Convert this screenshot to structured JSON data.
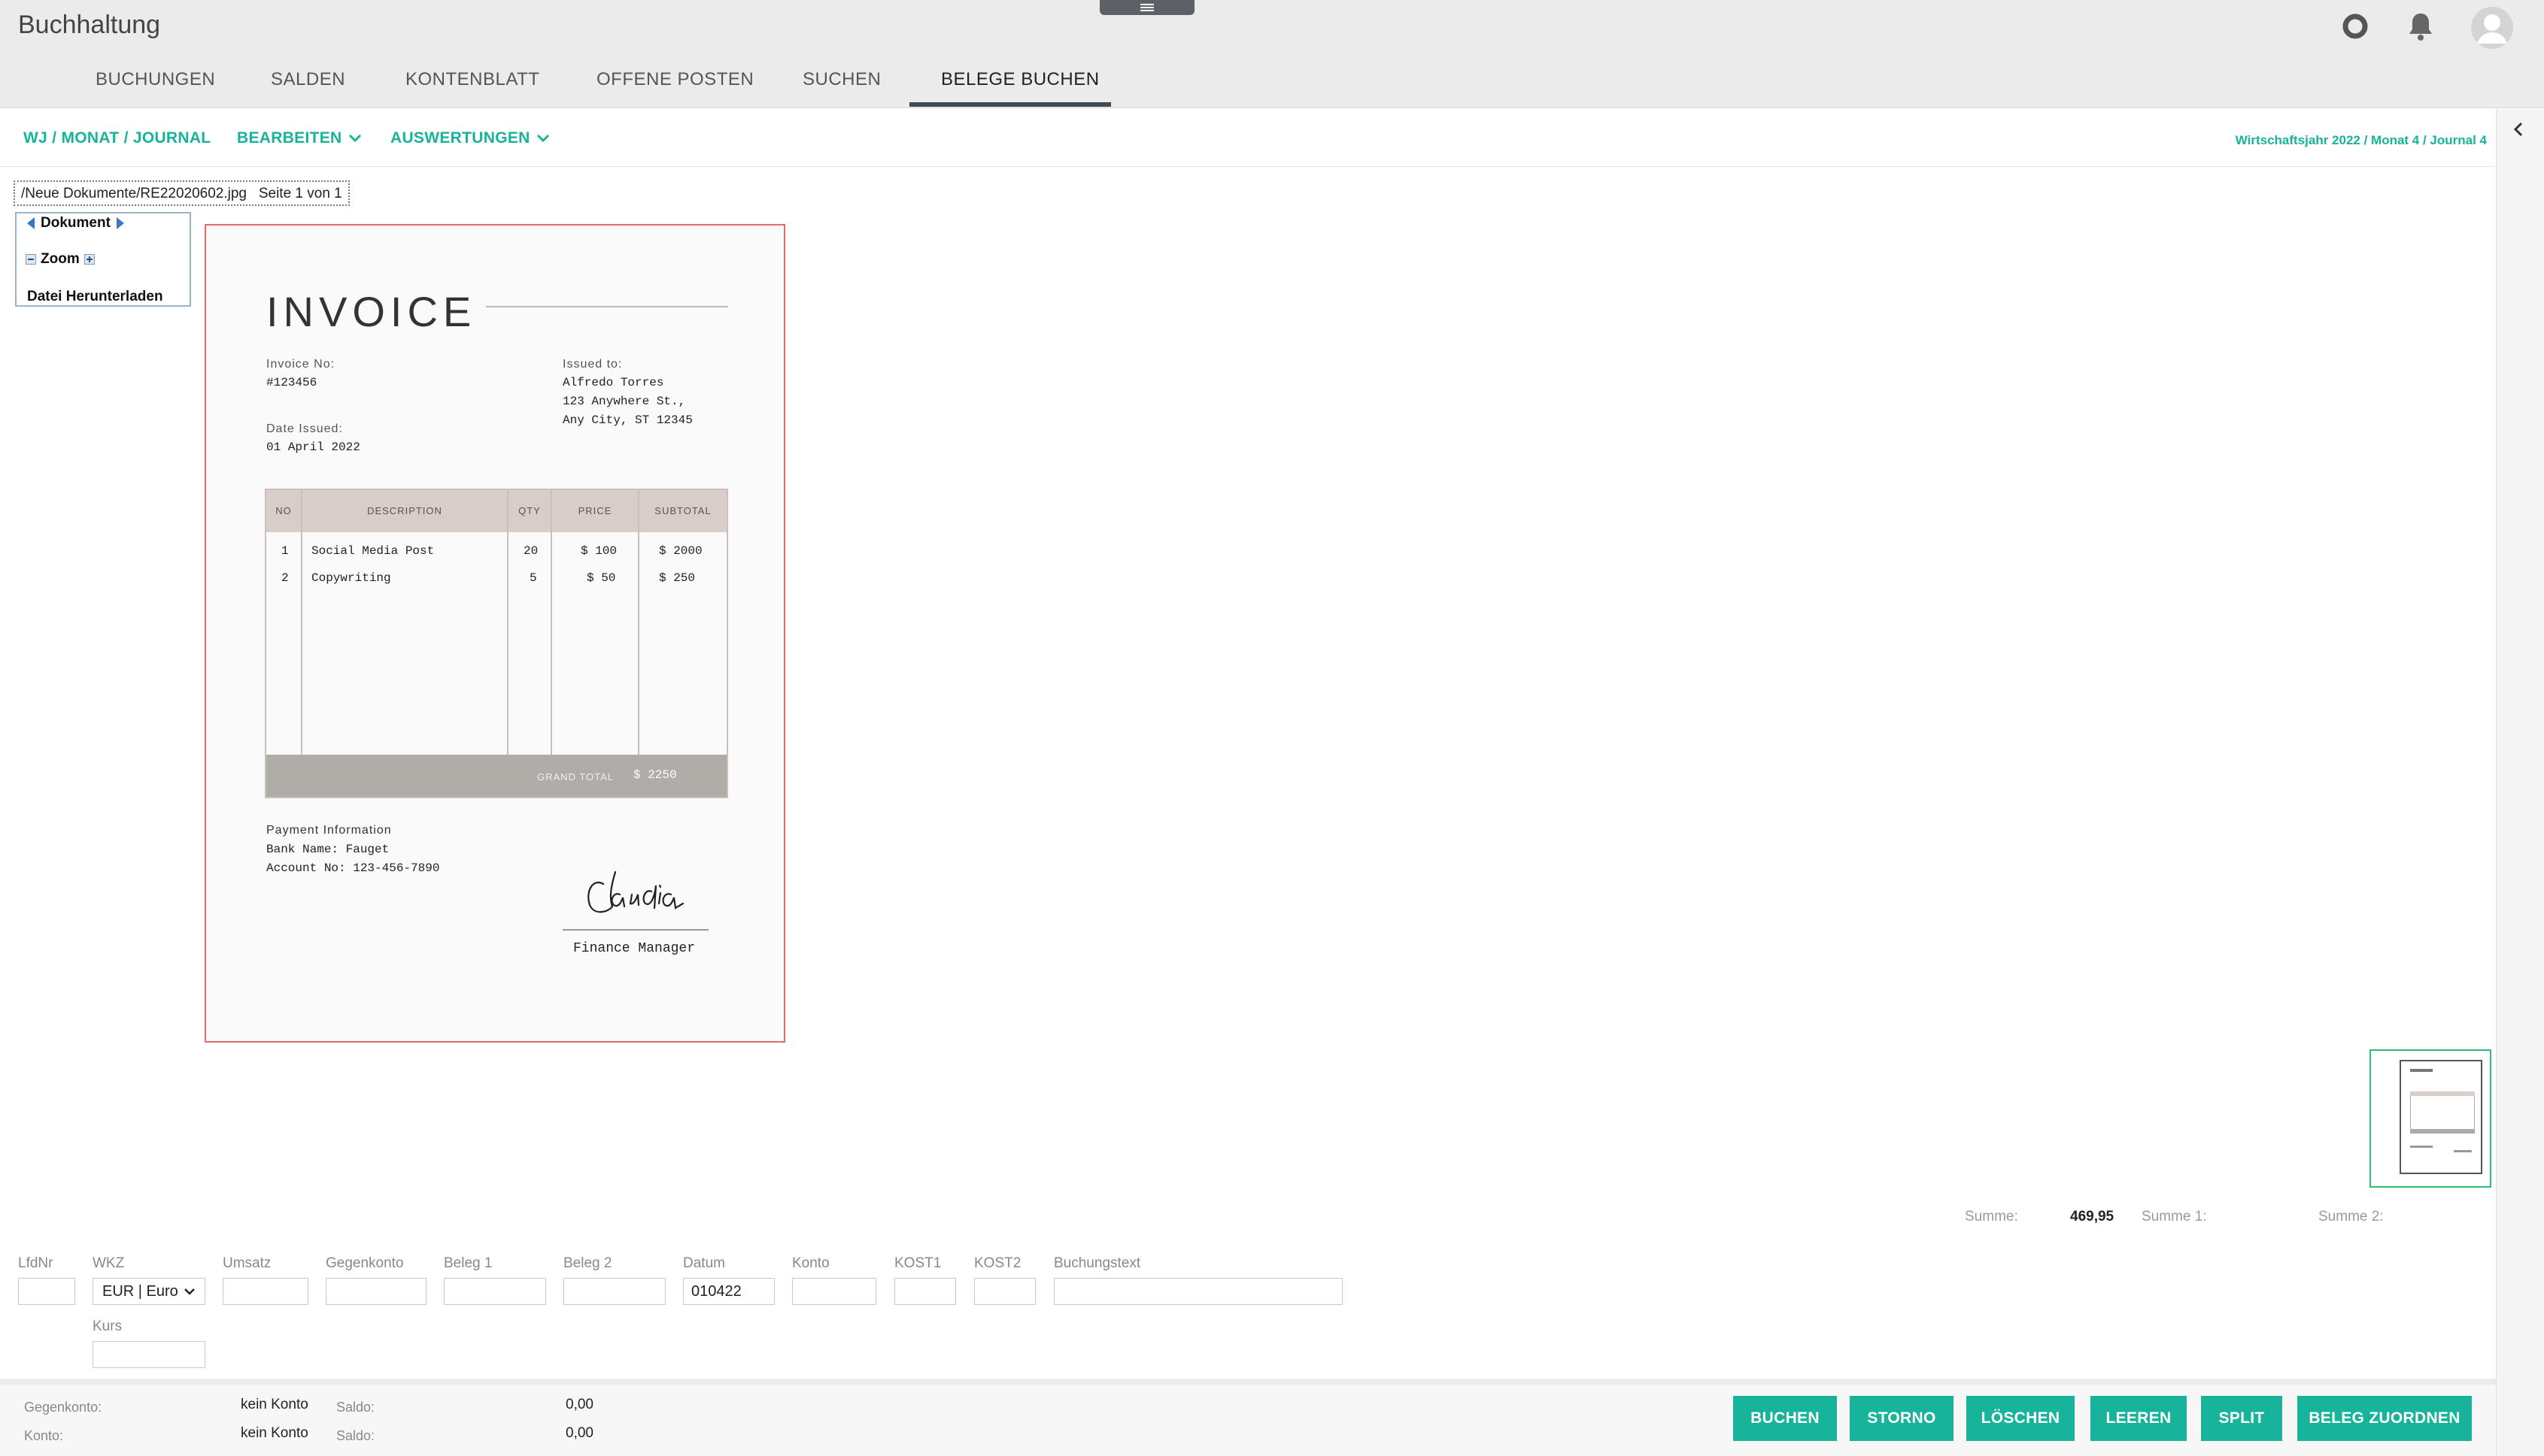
{
  "app": {
    "title": "Buchhaltung"
  },
  "header": {
    "icons": [
      "help-ring-icon",
      "bell-icon",
      "user-avatar-icon"
    ],
    "tabs": [
      {
        "label": "BUCHUNGEN"
      },
      {
        "label": "SALDEN"
      },
      {
        "label": "KONTENBLATT"
      },
      {
        "label": "OFFENE POSTEN"
      },
      {
        "label": "SUCHEN"
      },
      {
        "label": "BELEGE BUCHEN",
        "active": true
      }
    ]
  },
  "toolbar": {
    "wj": "WJ / MONAT / JOURNAL",
    "bearbeiten": "BEARBEITEN",
    "auswertungen": "AUSWERTUNGEN",
    "journal_info": "Wirtschaftsjahr 2022 / Monat 4 / Journal 4",
    "accent_color": "#17b39a"
  },
  "viewer": {
    "path": "/Neue Dokumente/RE22020602.jpg",
    "page": "Seite 1 von 1",
    "menu": {
      "document": "Dokument",
      "zoom": "Zoom",
      "download": "Datei Herunterladen"
    }
  },
  "invoice": {
    "title": "INVOICE",
    "invoice_no_label": "Invoice No:",
    "invoice_no": "#123456",
    "date_label": "Date Issued:",
    "date": "01 April 2022",
    "issued_to_label": "Issued to:",
    "issued_to": [
      "Alfredo Torres",
      "123 Anywhere St.,",
      "Any City, ST 12345"
    ],
    "columns": [
      "NO",
      "DESCRIPTION",
      "QTY",
      "PRICE",
      "SUBTOTAL"
    ],
    "rows": [
      {
        "no": "1",
        "description": "Social Media Post",
        "qty": "20",
        "price": "$ 100",
        "subtotal": "$ 2000"
      },
      {
        "no": "2",
        "description": "Copywriting",
        "qty": "5",
        "price": "$ 50",
        "subtotal": "$ 250"
      }
    ],
    "grand_total_label": "GRAND TOTAL",
    "grand_total": "$ 2250",
    "payment_label": "Payment Information",
    "bank_name": "Bank Name: Fauget",
    "account_no": "Account No: 123-456-7890",
    "signature": "Claudia",
    "signer_title": "Finance Manager"
  },
  "sums": {
    "summe_label": "Summe:",
    "summe": "469,95",
    "summe1_label": "Summe 1:",
    "summe2_label": "Summe 2:"
  },
  "form": {
    "labels": {
      "lfdnr": "LfdNr",
      "wkz": "WKZ",
      "umsatz": "Umsatz",
      "gegenkonto": "Gegenkonto",
      "beleg1": "Beleg 1",
      "beleg2": "Beleg 2",
      "datum": "Datum",
      "konto": "Konto",
      "kost1": "KOST1",
      "kost2": "KOST2",
      "buchungstext": "Buchungstext",
      "kurs": "Kurs"
    },
    "wkz_value": "EUR | Euro",
    "datum_value": "010422"
  },
  "footer": {
    "gegenkonto_label": "Gegenkonto:",
    "gegenkonto_value": "kein Konto",
    "konto_label": "Konto:",
    "konto_value": "kein Konto",
    "saldo_label": "Saldo:",
    "saldo1": "0,00",
    "saldo2": "0,00",
    "buttons": [
      "BUCHEN",
      "STORNO",
      "LÖSCHEN",
      "LEEREN",
      "SPLIT",
      "BELEG ZUORDNEN"
    ]
  }
}
